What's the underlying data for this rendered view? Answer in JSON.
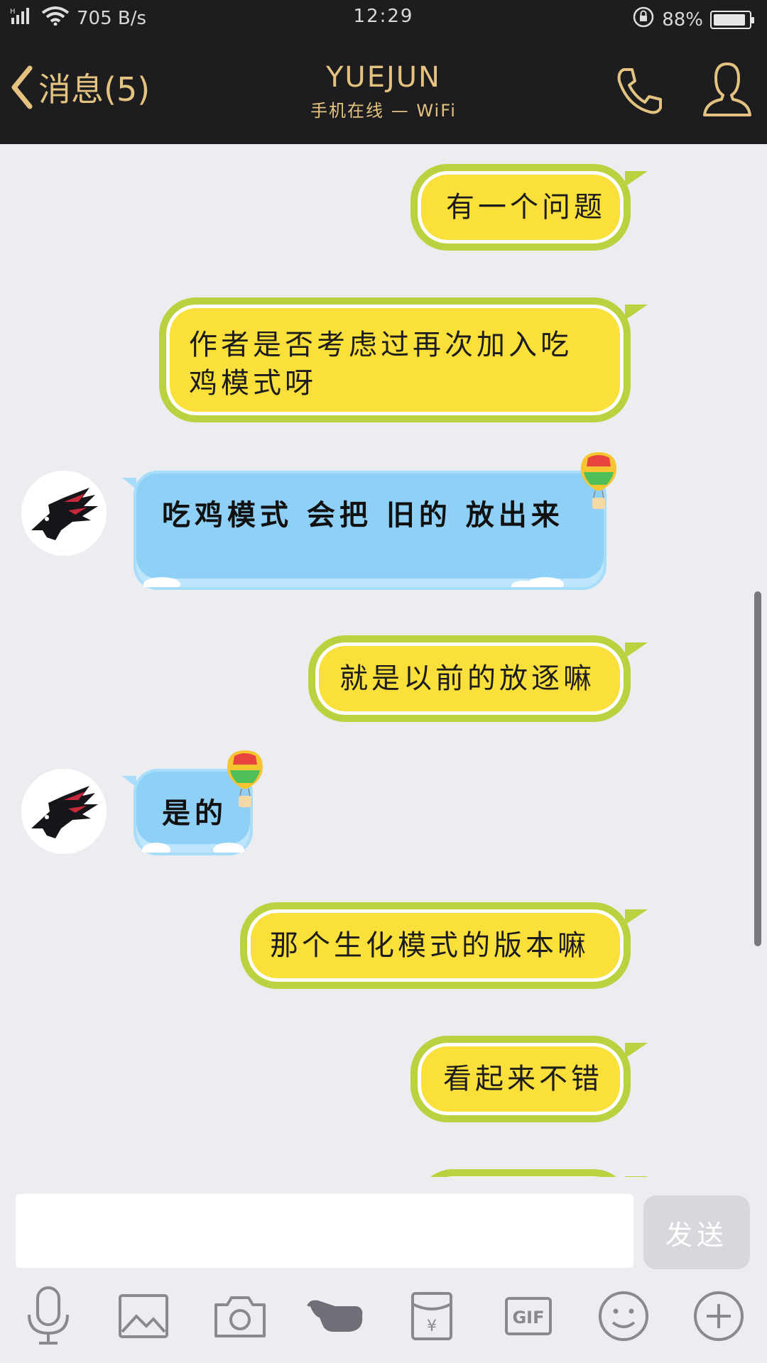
{
  "status_bar": {
    "signal": "H",
    "speed": "705 B/s",
    "time": "12:29",
    "battery": "88%",
    "battery_level": 0.88
  },
  "header": {
    "back_label": "消息(5)",
    "contact_name": "YUEJUN",
    "contact_status": "手机在线 — WiFi"
  },
  "messages": [
    {
      "side": "right",
      "text": "有一个问题"
    },
    {
      "side": "right",
      "text": "作者是否考虑过再次加入吃鸡模式呀"
    },
    {
      "side": "left",
      "text": "吃鸡模式  会把 旧的 放出来"
    },
    {
      "side": "right",
      "text": "就是以前的放逐嘛"
    },
    {
      "side": "left",
      "text": "是的"
    },
    {
      "side": "right",
      "text": "那个生化模式的版本嘛"
    },
    {
      "side": "right",
      "text": "看起来不错"
    }
  ],
  "input": {
    "value": "",
    "send_label": "发送"
  },
  "toolbar": {
    "icons": [
      "microphone-icon",
      "image-icon",
      "camera-icon",
      "poke-icon",
      "red-packet-icon",
      "gif-icon",
      "emoji-icon",
      "plus-icon"
    ],
    "gif_label": "GIF",
    "redpacket_label": "¥"
  },
  "colors": {
    "header_bg": "#1d1d1f",
    "header_accent": "#e4c380",
    "bubble_yellow": "#fbdf3a",
    "bubble_yellow_border": "#bcd13f",
    "bubble_blue": "#8fd0f6",
    "chat_bg": "#ecedf1"
  }
}
